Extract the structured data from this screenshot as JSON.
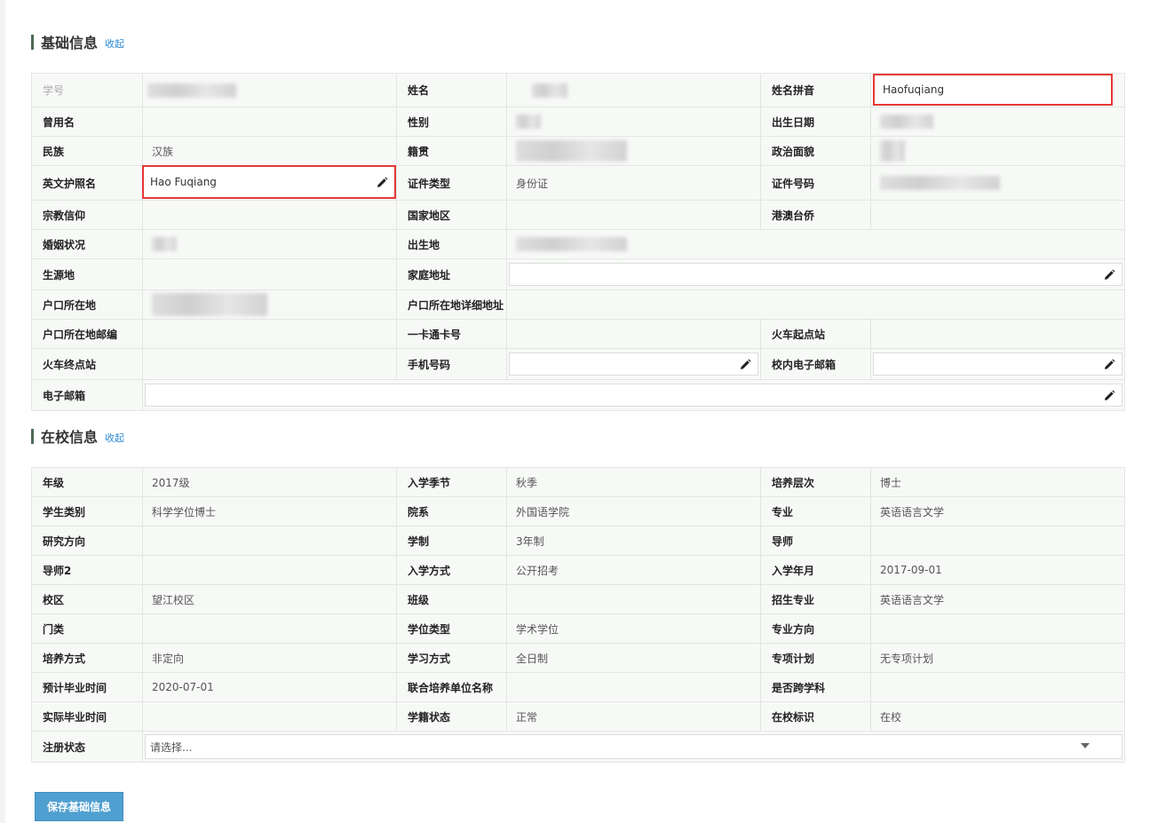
{
  "basic_section": {
    "title": "基础信息",
    "toggle": "收起",
    "rows": [
      [
        {
          "label": "学号",
          "value": ""
        },
        {
          "label": "姓名",
          "value": ""
        },
        {
          "label": "姓名拼音",
          "value": "Haofuqiang"
        }
      ],
      [
        {
          "label": "曾用名",
          "value": ""
        },
        {
          "label": "性别",
          "value": ""
        },
        {
          "label": "出生日期",
          "value": ""
        }
      ],
      [
        {
          "label": "民族",
          "value": "汉族"
        },
        {
          "label": "籍贯",
          "value": ""
        },
        {
          "label": "政治面貌",
          "value": ""
        }
      ],
      [
        {
          "label": "英文护照名",
          "value": "Hao Fuqiang"
        },
        {
          "label": "证件类型",
          "value": "身份证"
        },
        {
          "label": "证件号码",
          "value": ""
        }
      ],
      [
        {
          "label": "宗教信仰",
          "value": ""
        },
        {
          "label": "国家地区",
          "value": ""
        },
        {
          "label": "港澳台侨",
          "value": ""
        }
      ],
      [
        {
          "label": "婚姻状况",
          "value": ""
        },
        {
          "label": "出生地",
          "value": ""
        }
      ],
      [
        {
          "label": "生源地",
          "value": ""
        },
        {
          "label": "家庭地址",
          "value": ""
        }
      ],
      [
        {
          "label": "户口所在地",
          "value": ""
        },
        {
          "label": "户口所在地详细地址",
          "value": ""
        }
      ],
      [
        {
          "label": "户口所在地邮编",
          "value": ""
        },
        {
          "label": "一卡通卡号",
          "value": ""
        },
        {
          "label": "火车起点站",
          "value": ""
        }
      ],
      [
        {
          "label": "火车终点站",
          "value": ""
        },
        {
          "label": "手机号码",
          "value": ""
        },
        {
          "label": "校内电子邮箱",
          "value": ""
        }
      ],
      [
        {
          "label": "电子邮箱",
          "value": ""
        }
      ]
    ]
  },
  "school_section": {
    "title": "在校信息",
    "toggle": "收起",
    "rows": [
      [
        {
          "label": "年级",
          "value": "2017级"
        },
        {
          "label": "入学季节",
          "value": "秋季"
        },
        {
          "label": "培养层次",
          "value": "博士"
        }
      ],
      [
        {
          "label": "学生类别",
          "value": "科学学位博士"
        },
        {
          "label": "院系",
          "value": "外国语学院"
        },
        {
          "label": "专业",
          "value": "英语语言文学"
        }
      ],
      [
        {
          "label": "研究方向",
          "value": ""
        },
        {
          "label": "学制",
          "value": "3年制"
        },
        {
          "label": "导师",
          "value": ""
        }
      ],
      [
        {
          "label": "导师2",
          "value": ""
        },
        {
          "label": "入学方式",
          "value": "公开招考"
        },
        {
          "label": "入学年月",
          "value": "2017-09-01"
        }
      ],
      [
        {
          "label": "校区",
          "value": "望江校区"
        },
        {
          "label": "班级",
          "value": ""
        },
        {
          "label": "招生专业",
          "value": "英语语言文学"
        }
      ],
      [
        {
          "label": "门类",
          "value": ""
        },
        {
          "label": "学位类型",
          "value": "学术学位"
        },
        {
          "label": "专业方向",
          "value": ""
        }
      ],
      [
        {
          "label": "培养方式",
          "value": "非定向"
        },
        {
          "label": "学习方式",
          "value": "全日制"
        },
        {
          "label": "专项计划",
          "value": "无专项计划"
        }
      ],
      [
        {
          "label": "预计毕业时间",
          "value": "2020-07-01"
        },
        {
          "label": "联合培养单位名称",
          "value": ""
        },
        {
          "label": "是否跨学科",
          "value": ""
        }
      ],
      [
        {
          "label": "实际毕业时间",
          "value": ""
        },
        {
          "label": "学籍状态",
          "value": "正常"
        },
        {
          "label": "在校标识",
          "value": "在校"
        }
      ],
      [
        {
          "label": "注册状态",
          "value": "请选择..."
        }
      ]
    ]
  },
  "save_button": "保存基础信息",
  "colors": {
    "accent_bar": "#4d6b55",
    "link": "#2b8ad6",
    "highlight": "#e53935",
    "button": "#4fa0d0"
  }
}
